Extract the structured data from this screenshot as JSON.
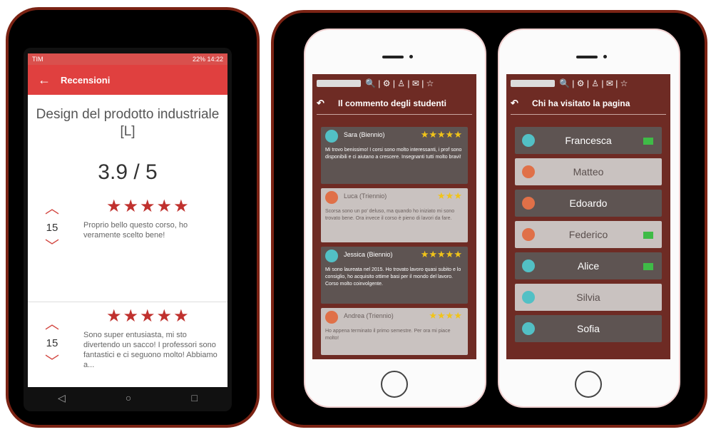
{
  "android": {
    "status_left": "TIM",
    "status_right": "22% 14:22",
    "appbar": {
      "back_icon": "←",
      "title": "Recensioni"
    },
    "course_title": "Design del prodotto industriale [L]",
    "rating": "3.9 / 5",
    "reviews": [
      {
        "votes": "15",
        "stars": "★★★★★",
        "text": "Proprio bello questo corso, ho veramente scelto bene!"
      },
      {
        "votes": "15",
        "stars": "★★★★★",
        "text": "Sono super entusiasta, mi sto divertendo un sacco! I professori sono fantastici e ci seguono molto! Abbiamo a..."
      }
    ],
    "nav": {
      "back": "◁",
      "home": "○",
      "recent": "□"
    }
  },
  "iphone_comments": {
    "header": "Il commento degli studenti",
    "back_icon": "↶",
    "toolbar_icons": "🔍 | ⚙ | ♙ | ✉ | ☆",
    "comments": [
      {
        "name": "Sara",
        "tag": "(Biennio)",
        "stars": "★★★★★",
        "text": "Mi trovo benissimo! I corsi sono molto interessanti, i prof sono disponibili e ci aiutano a crescere. Insegnanti tutti molto bravi!"
      },
      {
        "name": "Luca",
        "tag": "(Triennio)",
        "stars": "★★★",
        "text": "Scorsa sono un po' deluso, ma quando ho iniziato mi sono trovato bene. Ora invece il corso è pieno di lavori da fare."
      },
      {
        "name": "Jessica",
        "tag": "(Biennio)",
        "stars": "★★★★★",
        "text": "Mi sono laureata nel 2015. Ho trovato lavoro quasi subito e lo consiglio, ho acquisito ottime basi per il mondo del lavoro. Corso molto coinvolgente."
      },
      {
        "name": "Andrea",
        "tag": "(Triennio)",
        "stars": "★★★★",
        "text": "Ho appena terminato il primo semestre. Per ora mi piace molto!"
      }
    ]
  },
  "iphone_visitors": {
    "header": "Chi ha visitato la pagina",
    "back_icon": "↶",
    "toolbar_icons": "🔍 | ⚙ | ♙ | ✉ | ☆",
    "visitors": [
      {
        "name": "Francesca",
        "online": true,
        "gender": "f"
      },
      {
        "name": "Matteo",
        "online": false,
        "gender": "m"
      },
      {
        "name": "Edoardo",
        "online": false,
        "gender": "m"
      },
      {
        "name": "Federico",
        "online": true,
        "gender": "m"
      },
      {
        "name": "Alice",
        "online": true,
        "gender": "f"
      },
      {
        "name": "Silvia",
        "online": false,
        "gender": "f"
      },
      {
        "name": "Sofia",
        "online": false,
        "gender": "f"
      }
    ]
  }
}
